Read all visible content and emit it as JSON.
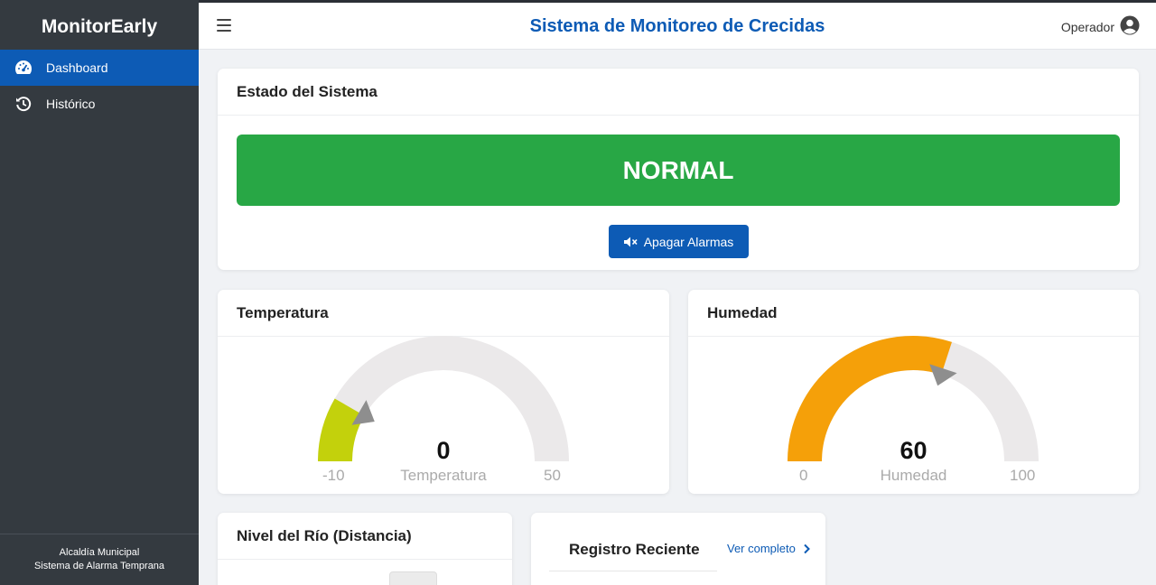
{
  "sidebar": {
    "brand": "MonitorEarly",
    "items": [
      {
        "label": "Dashboard",
        "icon": "gauge-icon",
        "active": true
      },
      {
        "label": "Histórico",
        "icon": "history-icon",
        "active": false
      }
    ],
    "footer_line1": "Alcaldía Municipal",
    "footer_line2": "Sistema de Alarma Temprana"
  },
  "header": {
    "title": "Sistema de Monitoreo de Crecidas",
    "user_label": "Operador"
  },
  "status_card": {
    "title": "Estado del Sistema",
    "status": "NORMAL",
    "status_color": "#28a745",
    "alarm_button": "Apagar Alarmas"
  },
  "temperature": {
    "title": "Temperatura",
    "value": "0",
    "label": "Temperatura",
    "min": "-10",
    "max": "50",
    "fill_fraction": 0.1667,
    "fill_color": "#c3d10c"
  },
  "humidity": {
    "title": "Humedad",
    "value": "60",
    "label": "Humedad",
    "min": "0",
    "max": "100",
    "fill_fraction": 0.6,
    "fill_color": "#f5a009"
  },
  "river_card": {
    "title": "Nivel del Río (Distancia)"
  },
  "records_card": {
    "title": "Registro Reciente",
    "link": "Ver completo"
  },
  "colors": {
    "primary": "#0d5bb5",
    "sidebar": "#343a40",
    "track": "#ebe9ea",
    "needle": "#8e8e8e"
  }
}
